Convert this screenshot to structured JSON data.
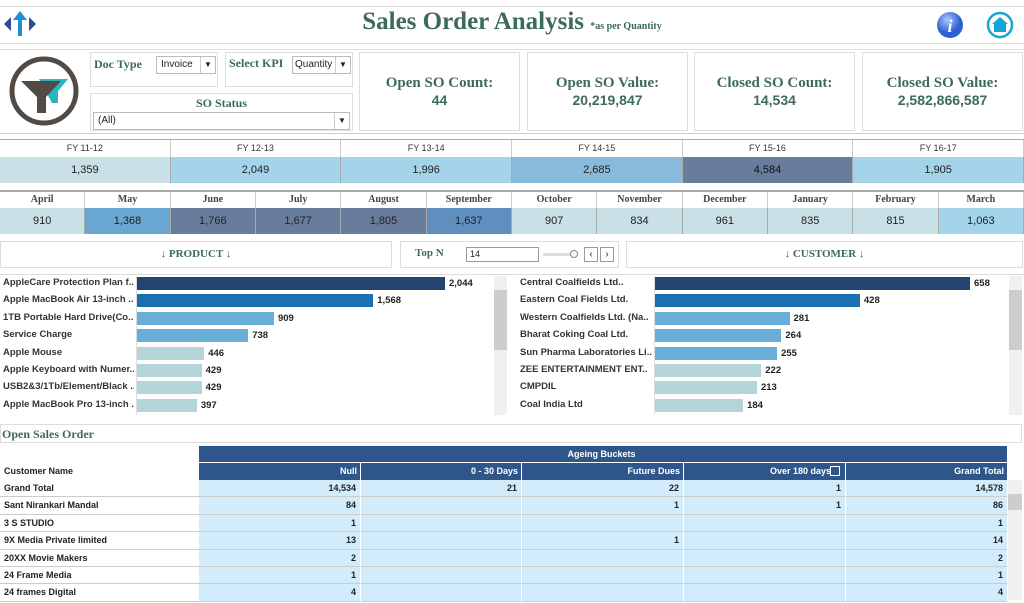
{
  "header": {
    "title": "Sales Order Analysis",
    "subtitle": "*as per Quantity",
    "nav_icon": "arrows-nav-icon",
    "info_icon": "info-icon",
    "home_icon": "home-icon"
  },
  "filters": {
    "doc_type_label": "Doc Type",
    "doc_type_value": "Invoice",
    "kpi_label": "Select KPI",
    "kpi_value": "Quantity",
    "so_status_label": "SO Status",
    "so_status_value": "(All)",
    "filter_icon": "funnel-icon"
  },
  "kpis": [
    {
      "label": "Open SO Count:",
      "value": "44"
    },
    {
      "label": "Open SO Value:",
      "value": "20,219,847"
    },
    {
      "label": "Closed SO Count:",
      "value": "14,534"
    },
    {
      "label": "Closed SO Value:",
      "value": "2,582,866,587"
    }
  ],
  "fiscal_years": [
    {
      "label": "FY 11-12",
      "value": "1,359",
      "color": "#c9e0e6"
    },
    {
      "label": "FY 12-13",
      "value": "2,049",
      "color": "#a3d4ea"
    },
    {
      "label": "FY 13-14",
      "value": "1,996",
      "color": "#a3d4ea"
    },
    {
      "label": "FY 14-15",
      "value": "2,685",
      "color": "#87badb"
    },
    {
      "label": "FY 15-16",
      "value": "4,584",
      "color": "#687d9b"
    },
    {
      "label": "FY 16-17",
      "value": "1,905",
      "color": "#a3d4ea"
    }
  ],
  "months": [
    {
      "label": "April",
      "value": "910",
      "color": "#c9e0e6"
    },
    {
      "label": "May",
      "value": "1,368",
      "color": "#6aa7d2"
    },
    {
      "label": "June",
      "value": "1,766",
      "color": "#687d9b"
    },
    {
      "label": "July",
      "value": "1,677",
      "color": "#687d9b"
    },
    {
      "label": "August",
      "value": "1,805",
      "color": "#687d9b"
    },
    {
      "label": "September",
      "value": "1,637",
      "color": "#5f8fbe"
    },
    {
      "label": "October",
      "value": "907",
      "color": "#c9e0e6"
    },
    {
      "label": "November",
      "value": "834",
      "color": "#c9e0e6"
    },
    {
      "label": "December",
      "value": "961",
      "color": "#c9e0e6"
    },
    {
      "label": "January",
      "value": "835",
      "color": "#c9e0e6"
    },
    {
      "label": "February",
      "value": "815",
      "color": "#c9e0e6"
    },
    {
      "label": "March",
      "value": "1,063",
      "color": "#a3d4ea"
    }
  ],
  "controls": {
    "product_label": "↓ PRODUCT ↓",
    "topn_label": "Top N",
    "topn_value": "14",
    "customer_label": "↓ CUSTOMER ↓"
  },
  "chart_data": [
    {
      "type": "bar",
      "orientation": "horizontal",
      "categories": [
        "AppleCare Protection Plan f..",
        "Apple MacBook Air 13-inch ..",
        "1TB Portable Hard Drive(Co..",
        "Service Charge",
        "Apple Mouse",
        "Apple Keyboard with Numer..",
        "USB2&3/1Tb/Element/Black ..",
        "Apple MacBook Pro 13-inch .."
      ],
      "values": [
        2044,
        1568,
        909,
        738,
        446,
        429,
        429,
        397
      ],
      "labels": [
        "2,044",
        "1,568",
        "909",
        "738",
        "446",
        "429",
        "429",
        "397"
      ],
      "colors": [
        "#26456e",
        "#1b70b0",
        "#68aed6",
        "#68aed6",
        "#b4d4da",
        "#b4d4da",
        "#b4d4da",
        "#b4d4da"
      ]
    },
    {
      "type": "bar",
      "orientation": "horizontal",
      "categories": [
        "Central Coalfields Ltd..",
        "Eastern Coal Fields Ltd.",
        "Western Coalfields Ltd. (Na..",
        "Bharat Coking Coal Ltd.",
        "Sun Pharma Laboratories Li..",
        "ZEE ENTERTAINMENT ENT..",
        "CMPDIL",
        "Coal India Ltd"
      ],
      "values": [
        658,
        428,
        281,
        264,
        255,
        222,
        213,
        184
      ],
      "labels": [
        "658",
        "428",
        "281",
        "264",
        "255",
        "222",
        "213",
        "184"
      ],
      "colors": [
        "#26456e",
        "#1b70b0",
        "#68aed6",
        "#68aed6",
        "#68aed6",
        "#b4d4da",
        "#b4d4da",
        "#b4d4da"
      ]
    }
  ],
  "table": {
    "section_title": "Open Sales Order",
    "group_header": "Ageing Buckets",
    "row_header": "Customer Name",
    "columns": [
      "Null",
      "0 - 30 Days",
      "Future Dues",
      "Over 180 days",
      "Grand Total"
    ],
    "rows": [
      [
        "Grand Total",
        "14,534",
        "21",
        "22",
        "1",
        "14,578"
      ],
      [
        "Sant Nirankari Mandal",
        "84",
        "",
        "1",
        "1",
        "86"
      ],
      [
        "3 S STUDIO",
        "1",
        "",
        "",
        "",
        "1"
      ],
      [
        "9X Media Private limited",
        "13",
        "",
        "1",
        "",
        "14"
      ],
      [
        "20XX Movie Makers",
        "2",
        "",
        "",
        "",
        "2"
      ],
      [
        "24 Frame Media",
        "1",
        "",
        "",
        "",
        "1"
      ],
      [
        "24 frames Digital",
        "4",
        "",
        "",
        "",
        "4"
      ]
    ]
  }
}
